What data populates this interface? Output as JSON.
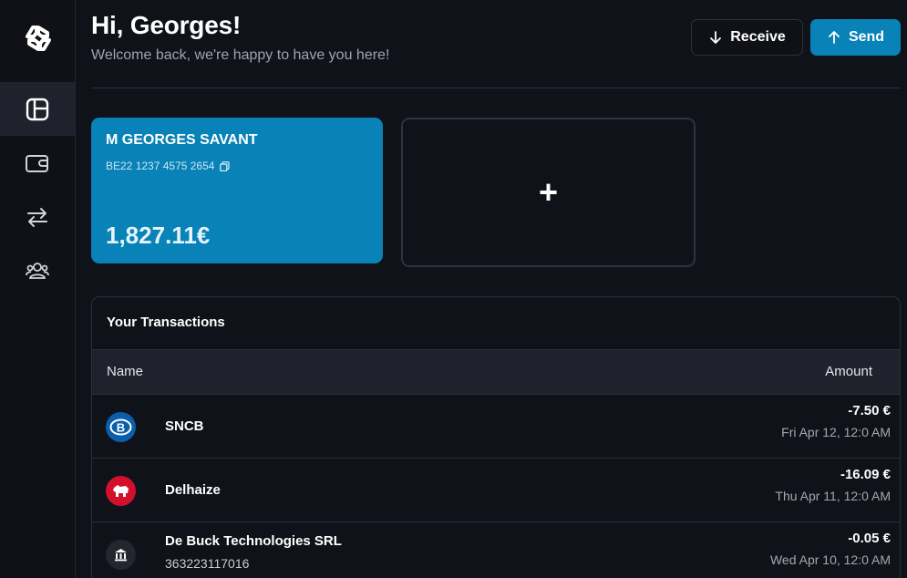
{
  "sidebar": {
    "logo": "exchange-logo-icon",
    "items": [
      {
        "icon": "dashboard-icon",
        "active": true
      },
      {
        "icon": "wallet-icon",
        "active": false
      },
      {
        "icon": "transfer-arrows-icon",
        "active": false
      },
      {
        "icon": "users-icon",
        "active": false
      }
    ]
  },
  "header": {
    "greeting": "Hi, Georges!",
    "subtitle": "Welcome back, we're happy to have you here!",
    "receive_label": "Receive",
    "send_label": "Send"
  },
  "account": {
    "holder": "M GEORGES SAVANT",
    "iban": "BE22 1237 4575 2654",
    "balance": "1,827.11€"
  },
  "add_account": {
    "symbol": "+"
  },
  "transactions": {
    "title": "Your Transactions",
    "columns": {
      "name": "Name",
      "amount": "Amount"
    },
    "rows": [
      {
        "name": "SNCB",
        "sub": "",
        "amount": "-7.50 €",
        "date": "Fri Apr 12, 12:0 AM",
        "icon": "sncb-logo-icon"
      },
      {
        "name": "Delhaize",
        "sub": "",
        "amount": "-16.09 €",
        "date": "Thu Apr 11, 12:0 AM",
        "icon": "delhaize-logo-icon"
      },
      {
        "name": "De Buck Technologies SRL",
        "sub": "363223117016",
        "amount": "-0.05 €",
        "date": "Wed Apr 10, 12:0 AM",
        "icon": "bank-icon"
      }
    ]
  },
  "colors": {
    "background": "#101219",
    "accent": "#0882b7",
    "panel_header": "#1f222c"
  }
}
